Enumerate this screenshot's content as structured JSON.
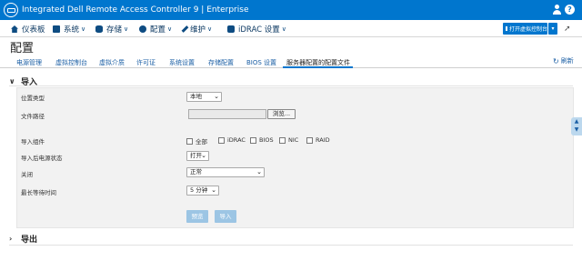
{
  "app": {
    "title": "Integrated Dell Remote Access Controller 9 | Enterprise"
  },
  "nav": {
    "items": [
      {
        "label": "仪表板",
        "icon": "home-icon",
        "has_menu": false
      },
      {
        "label": "系统",
        "icon": "server-icon",
        "has_menu": true
      },
      {
        "label": "存储",
        "icon": "storage-icon",
        "has_menu": true
      },
      {
        "label": "配置",
        "icon": "configuration-icon",
        "has_menu": true
      },
      {
        "label": "维护",
        "icon": "wrench-icon",
        "has_menu": true
      },
      {
        "label": "iDRAC 设置",
        "icon": "idrac-icon",
        "has_menu": true
      }
    ],
    "virtual_console_label": "打开虚拟控制台"
  },
  "page": {
    "title": "配置",
    "tabs": [
      "电源管理",
      "虚拟控制台",
      "虚拟介质",
      "许可证",
      "系统设置",
      "存储配置",
      "BIOS 设置",
      "服务器配置的配置文件"
    ],
    "active_tab": "服务器配置的配置文件",
    "refresh_label": "刷新"
  },
  "import_section": {
    "title": "导入",
    "location_type": {
      "label": "位置类型",
      "value": "本地"
    },
    "file_path": {
      "label": "文件路径",
      "value": "",
      "browse_label": "浏览..."
    },
    "components": {
      "label": "导入组件",
      "options": [
        {
          "label": "全部",
          "checked": false
        },
        {
          "label": "iDRAC",
          "checked": false
        },
        {
          "label": "BIOS",
          "checked": false
        },
        {
          "label": "NIC",
          "checked": false
        },
        {
          "label": "RAID",
          "checked": false
        }
      ]
    },
    "power_state": {
      "label": "导入后电源状态",
      "value": "打开"
    },
    "shutdown": {
      "label": "关闭",
      "value": "正常"
    },
    "max_wait": {
      "label": "最长等待时间",
      "value": "5 分钟"
    },
    "preview_label": "预览",
    "import_label": "导入"
  },
  "export_section": {
    "title": "导出"
  }
}
